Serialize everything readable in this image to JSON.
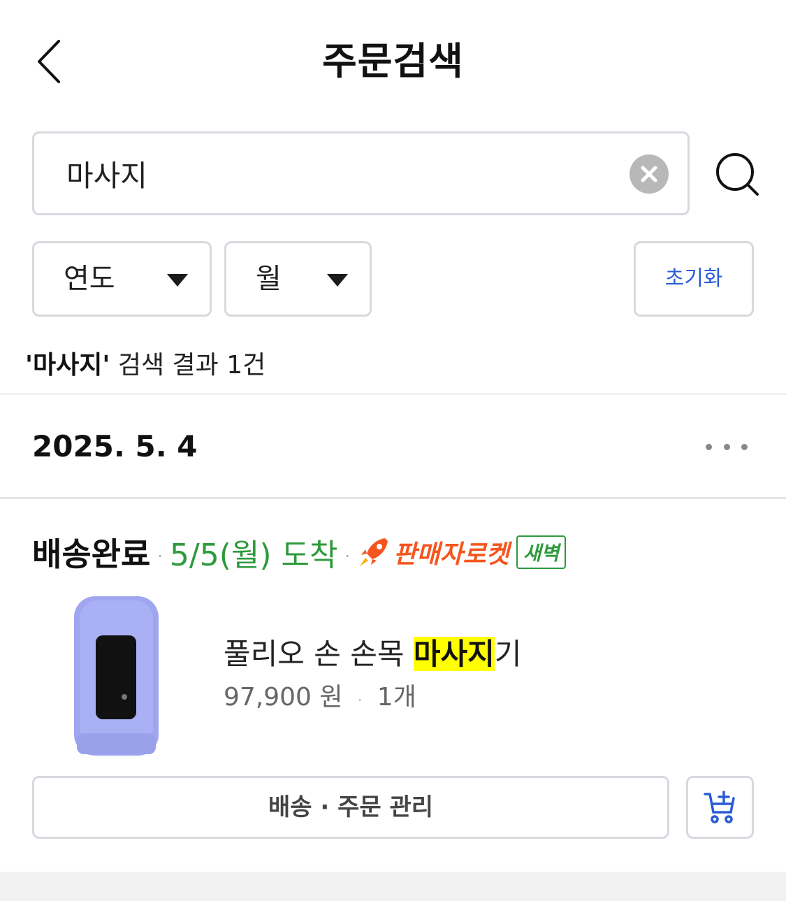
{
  "header": {
    "title": "주문검색",
    "back_icon": "chevron-left-icon"
  },
  "search": {
    "value": "마사지",
    "clear_icon": "close-circle-icon",
    "search_icon": "search-icon"
  },
  "filters": {
    "year_label": "연도",
    "month_label": "월",
    "reset_label": "초기화"
  },
  "result_summary": {
    "keyword": "'마사지'",
    "text": " 검색 결과 1건"
  },
  "order": {
    "date": "2025. 5. 4",
    "more_icon": "more-horizontal-icon",
    "status": "배송완료",
    "separator": "·",
    "arrival": "5/5(월) 도착",
    "delivery_type": "판매자로켓",
    "delivery_badge": "새벽",
    "product": {
      "name_prefix": "풀리오 손 손목 ",
      "name_highlight": "마사지",
      "name_suffix": "기",
      "price": "97,900 원",
      "quantity": "1개"
    },
    "manage_button": "배송 · 주문 관리",
    "cart_icon": "add-to-cart-icon"
  },
  "colors": {
    "accent_blue": "#2a5bd7",
    "arrival_green": "#2e9a3c",
    "rocket_orange": "#f5561f",
    "highlight_yellow": "#ffff00"
  }
}
